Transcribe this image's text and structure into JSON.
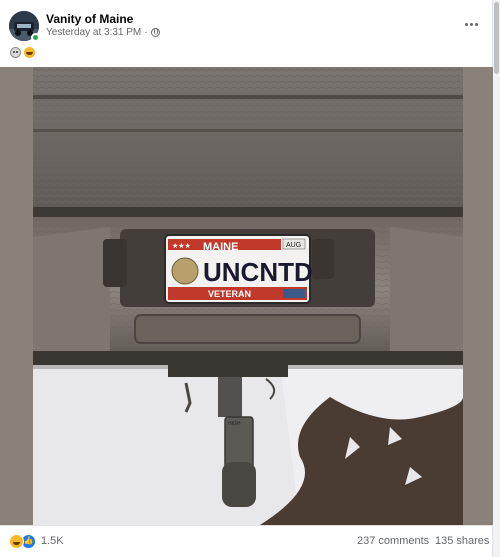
{
  "post": {
    "page_name": "Vanity of Maine",
    "timestamp": "Yesterday at 3:31 PM",
    "separator": "·",
    "visibility_icon": "globe-icon",
    "more_icon": "more-horizontal-icon",
    "caption_emojis": [
      "skull-icon",
      "laughing-emoji-icon"
    ]
  },
  "photo": {
    "plate": {
      "state": "MAINE",
      "month_sticker": "AUG",
      "number": "UNCNTD",
      "bottom_text": "VETERAN"
    },
    "hitch_stamp": "HIGH"
  },
  "footer": {
    "reaction_icons": [
      "haha-icon",
      "like-icon"
    ],
    "reaction_count": "1.5K",
    "comments": "237 comments",
    "shares": "135 shares"
  },
  "colors": {
    "link_blue": "#1877f2",
    "secondary_text": "#65676b",
    "online_green": "#31a24c"
  }
}
